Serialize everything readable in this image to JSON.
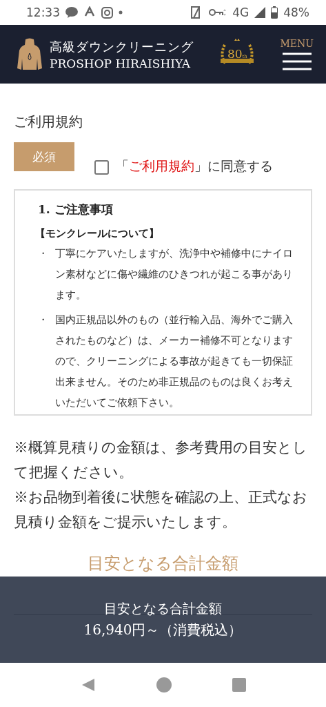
{
  "status_bar": {
    "time": "12:33",
    "network": "4G",
    "battery": "48%"
  },
  "header": {
    "title_ja": "高級ダウンクリーニング",
    "title_en": "PROSHOP HIRAISHIYA",
    "badge_number": "80",
    "badge_suffix": "th",
    "menu_label": "MENU"
  },
  "terms": {
    "label": "ご利用規約",
    "required": "必須",
    "agree": {
      "checked": false,
      "prefix": "「",
      "link": "ご利用規約",
      "suffix": "」に同意する"
    },
    "box": {
      "heading": "1. ご注意事項",
      "subheading": "【モンクレールについて】",
      "bullets": [
        {
          "mark": "・",
          "text": "丁寧にケアいたしますが、洗浄中や補修中にナイロン素材などに傷や繊維のひきつれが起こる事があります。"
        },
        {
          "mark": "・",
          "text": "国内正規品以外のもの（並行輸入品、海外でご購入されたものなど）は、メーカー補修不可となりますので、クリーニングによる事故が起きても一切保証出来ません。そのため非正規品のものは良くお考えいただいてご依頼下さい。"
        }
      ]
    }
  },
  "notes": [
    "※概算見積りの金額は、参考費用の目安として把握ください。",
    "※お品物到着後に状態を確認の上、正式なお見積り金額をご提示いたします。"
  ],
  "estimate": {
    "title": "目安となる合計金額"
  },
  "sticky_bar": {
    "title": "目安となる合計金額",
    "amount": "16,940円～（消費税込）"
  }
}
